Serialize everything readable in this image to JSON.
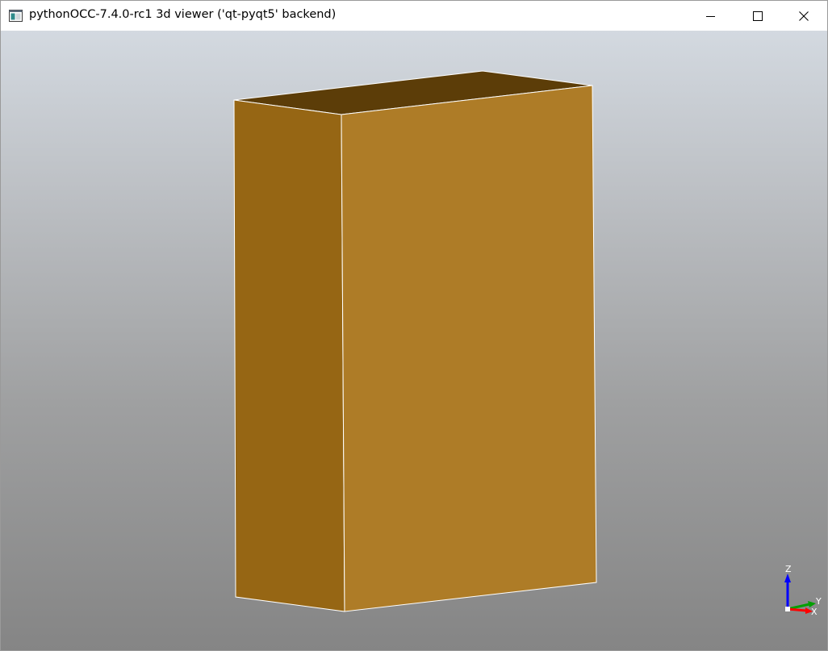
{
  "window": {
    "title": "pythonOCC-7.4.0-rc1 3d viewer ('qt-pyqt5' backend)",
    "app_icon": "app-window-icon",
    "caption_buttons": [
      {
        "name": "minimize",
        "icon": "minimize-icon"
      },
      {
        "name": "maximize",
        "icon": "maximize-icon"
      },
      {
        "name": "close",
        "icon": "close-icon"
      }
    ]
  },
  "viewer": {
    "background_gradient": [
      "#d3d9e0",
      "#858585"
    ],
    "shape": {
      "type": "box",
      "colors": {
        "front_face": "#ae7c27",
        "side_face": "#966614",
        "top_face": "#5c3d08",
        "edges": "#ffffff"
      }
    },
    "triedron": {
      "axes": [
        {
          "label": "Z",
          "color": "#0000ff"
        },
        {
          "label": "Y",
          "color": "#00a000"
        },
        {
          "label": "X",
          "color": "#ff0000"
        }
      ]
    }
  }
}
